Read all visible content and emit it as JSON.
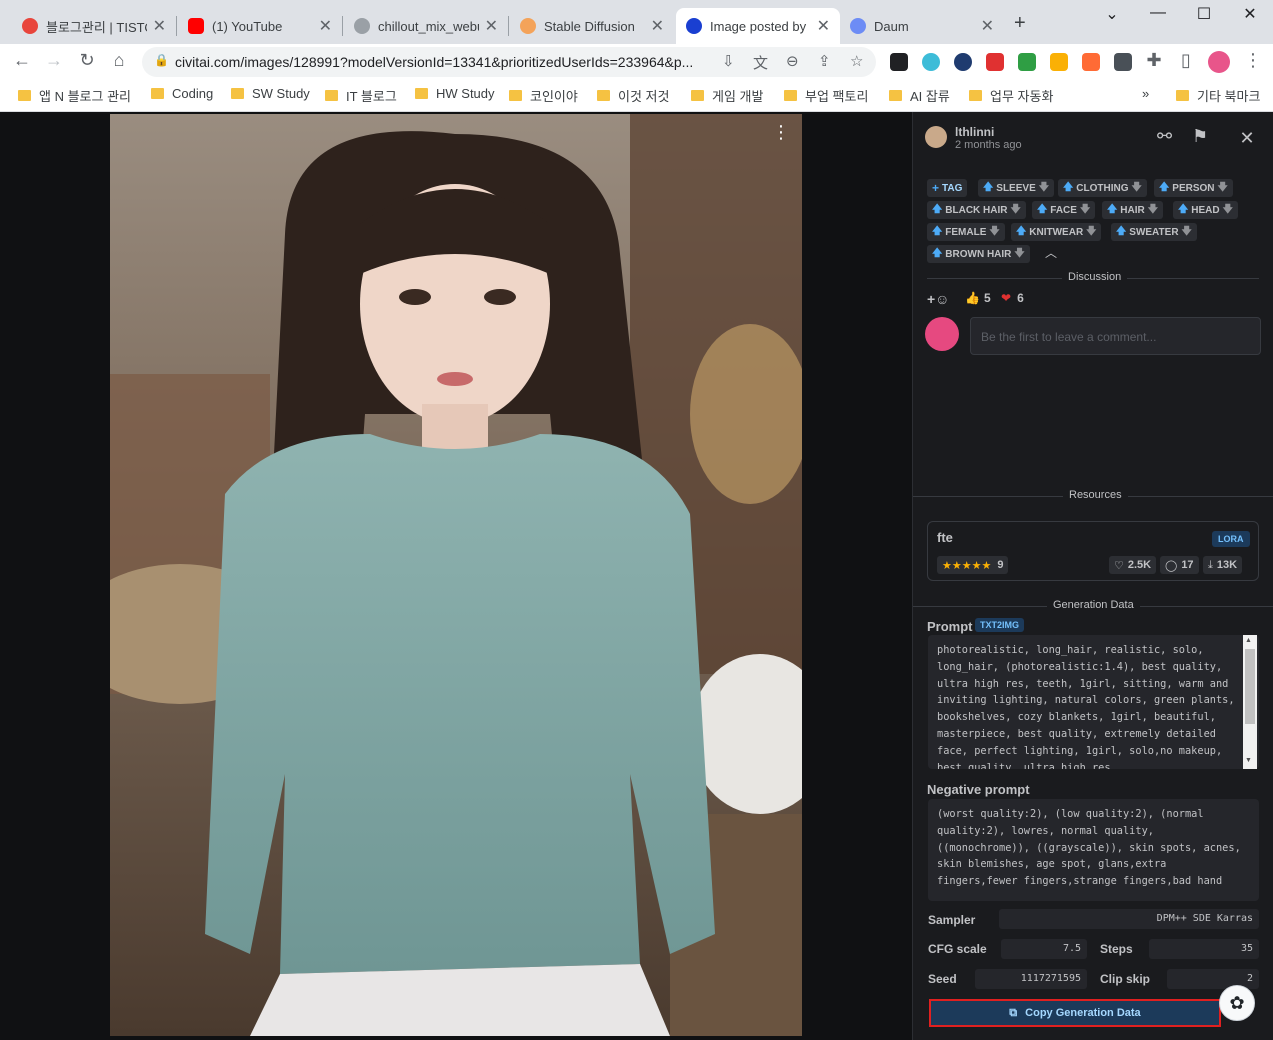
{
  "browser": {
    "tabs": [
      {
        "title": "블로그관리 | TISTO",
        "favicon_color": "#e8453c"
      },
      {
        "title": "(1) YouTube",
        "favicon_color": "#ff0000"
      },
      {
        "title": "chillout_mix_webui",
        "favicon_color": "#9aa0a6"
      },
      {
        "title": "Stable Diffusion",
        "favicon_color": "#f4a35a"
      },
      {
        "title": "Image posted by",
        "favicon_color": "#1a3fd1"
      },
      {
        "title": "Daum",
        "favicon_color": "#6d8cf5"
      }
    ],
    "url": "civitai.com/images/128991?modelVersionId=13341&prioritizedUserIds=233964&p...",
    "bookmarks": [
      "앱 N 블로그 관리",
      "Coding",
      "SW Study",
      "IT 블로그",
      "HW Study",
      "코인이야",
      "이것 저것",
      "게임 개발",
      "부업 팩토리",
      "AI 잡류",
      "업무 자동화",
      "기타 북마크"
    ],
    "more_bookmarks": "»"
  },
  "post": {
    "username": "lthlinni",
    "time": "2 months ago",
    "tags": [
      "SLEEVE",
      "CLOTHING",
      "PERSON",
      "BLACK HAIR",
      "FACE",
      "HAIR",
      "HEAD",
      "FEMALE",
      "KNITWEAR",
      "SWEATER",
      "BROWN HAIR"
    ],
    "add_tag_label": "TAG",
    "discussion_label": "Discussion",
    "reaction_like_count": "5",
    "reaction_heart_count": "6",
    "comment_placeholder": "Be the first to leave a comment...",
    "resources_label": "Resources",
    "resource": {
      "name": "fte",
      "type": "LORA",
      "rating_stars": "★★★★★",
      "rating_count": "9",
      "likes": "2.5K",
      "comments": "17",
      "downloads": "13K"
    },
    "generation_label": "Generation Data",
    "prompt_label": "Prompt",
    "prompt_badge": "TXT2IMG",
    "prompt": "photorealistic, long_hair, realistic, solo, long_hair, (photorealistic:1.4), best quality, ultra high res, teeth, 1girl, sitting, warm and inviting lighting, natural colors, green plants, bookshelves, cozy blankets, 1girl, beautiful, masterpiece, best quality, extremely detailed face, perfect lighting, 1girl, solo,no makeup, best quality, ultra high res,",
    "negative_label": "Negative prompt",
    "negative_prompt": "(worst quality:2), (low quality:2), (normal quality:2), lowres, normal quality, ((monochrome)), ((grayscale)), skin spots, acnes, skin blemishes, age spot, glans,extra fingers,fewer fingers,strange fingers,bad hand",
    "params": {
      "sampler_label": "Sampler",
      "sampler": "DPM++ SDE Karras",
      "cfg_label": "CFG scale",
      "cfg": "7.5",
      "steps_label": "Steps",
      "steps": "35",
      "seed_label": "Seed",
      "seed": "1117271595",
      "clip_label": "Clip skip",
      "clip": "2"
    },
    "copy_button": "Copy Generation Data"
  }
}
